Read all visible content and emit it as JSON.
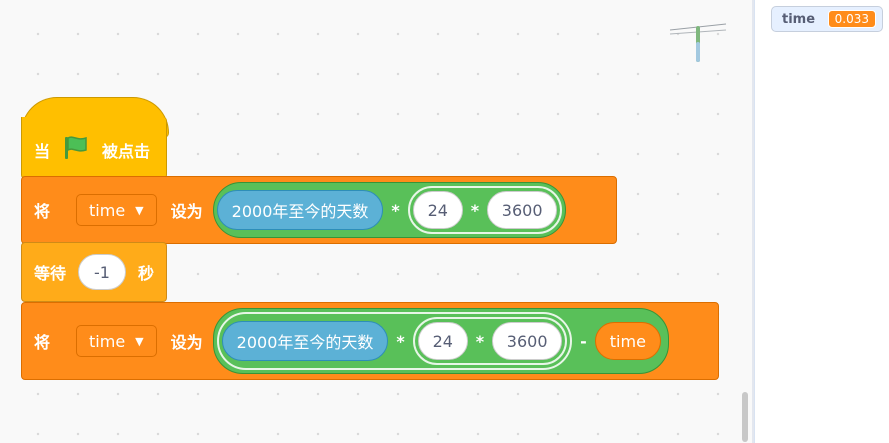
{
  "monitor": {
    "label": "time",
    "value": "0.033"
  },
  "hat": {
    "prefix": "当",
    "suffix": "被点击"
  },
  "set1": {
    "prefix": "将",
    "variable": "time",
    "to": "设为",
    "reporter": "2000年至今的天数",
    "op1": "*",
    "num1": "24",
    "op2": "*",
    "num2": "3600"
  },
  "wait": {
    "prefix": "等待",
    "value": "-1",
    "suffix": "秒"
  },
  "set2": {
    "prefix": "将",
    "variable": "time",
    "to": "设为",
    "reporter": "2000年至今的天数",
    "op1": "*",
    "num1": "24",
    "op2": "*",
    "num2": "3600",
    "op3": "-",
    "var_reporter": "time"
  },
  "icons": {
    "flag": "green-flag-icon",
    "caret": "dropdown-caret-icon",
    "sprite": "dragonfly-sprite"
  }
}
